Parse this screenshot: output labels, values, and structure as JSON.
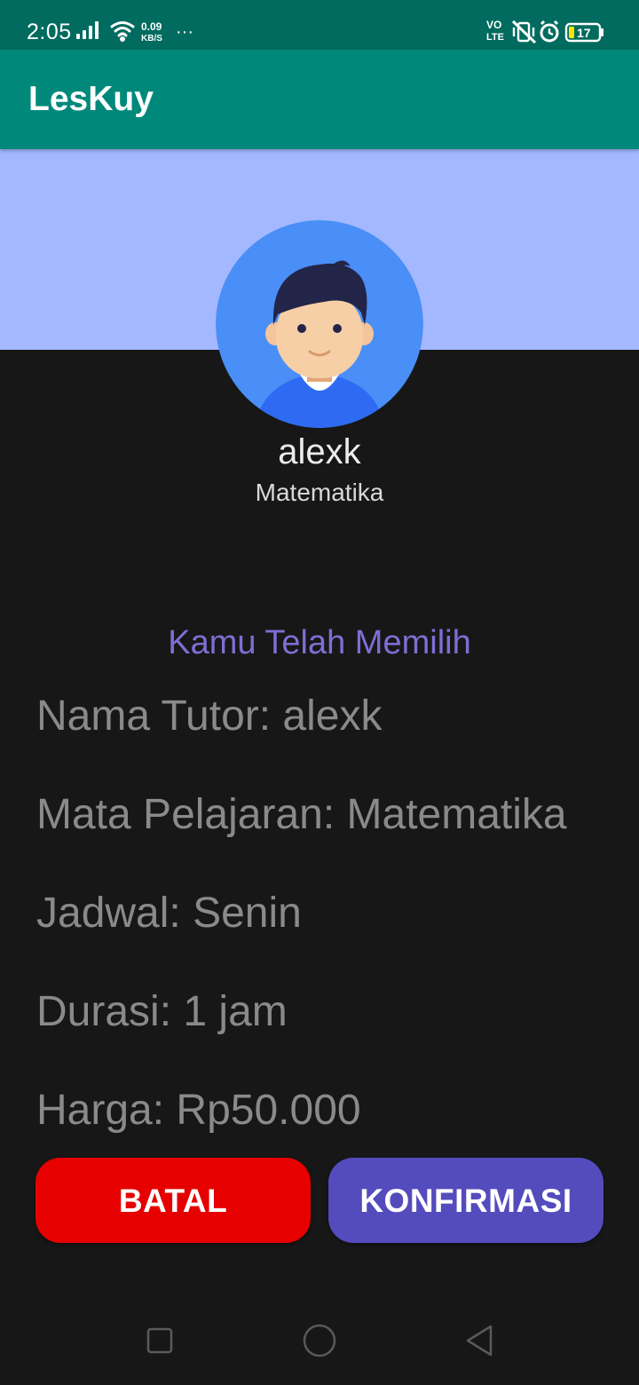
{
  "status_bar": {
    "time": "2:05",
    "net_speed_value": "0.09",
    "net_speed_unit": "KB/S",
    "more": "···",
    "volte_top": "VO",
    "volte_bottom": "LTE",
    "battery": "17"
  },
  "app_bar": {
    "title": "LesKuy"
  },
  "profile": {
    "name": "alexk",
    "subject": "Matematika",
    "avatar_icon": "user-avatar-icon"
  },
  "summary": {
    "heading": "Kamu Telah Memilih",
    "tutor": "Nama Tutor: alexk",
    "subject": "Mata Pelajaran: Matematika",
    "schedule": "Jadwal: Senin",
    "duration": "Durasi: 1 jam",
    "price": "Harga: Rp50.000"
  },
  "actions": {
    "cancel_label": "BATAL",
    "confirm_label": "KONFIRMASI"
  },
  "colors": {
    "status_bar": "#006b5e",
    "app_bar": "#00897b",
    "hero": "#a3b8ff",
    "background": "#171717",
    "heading": "#7c6fd4",
    "cancel": "#e60000",
    "confirm": "#544bbd"
  },
  "nav_bar": {
    "icons": [
      "recents-square-icon",
      "home-circle-icon",
      "back-triangle-icon"
    ]
  }
}
